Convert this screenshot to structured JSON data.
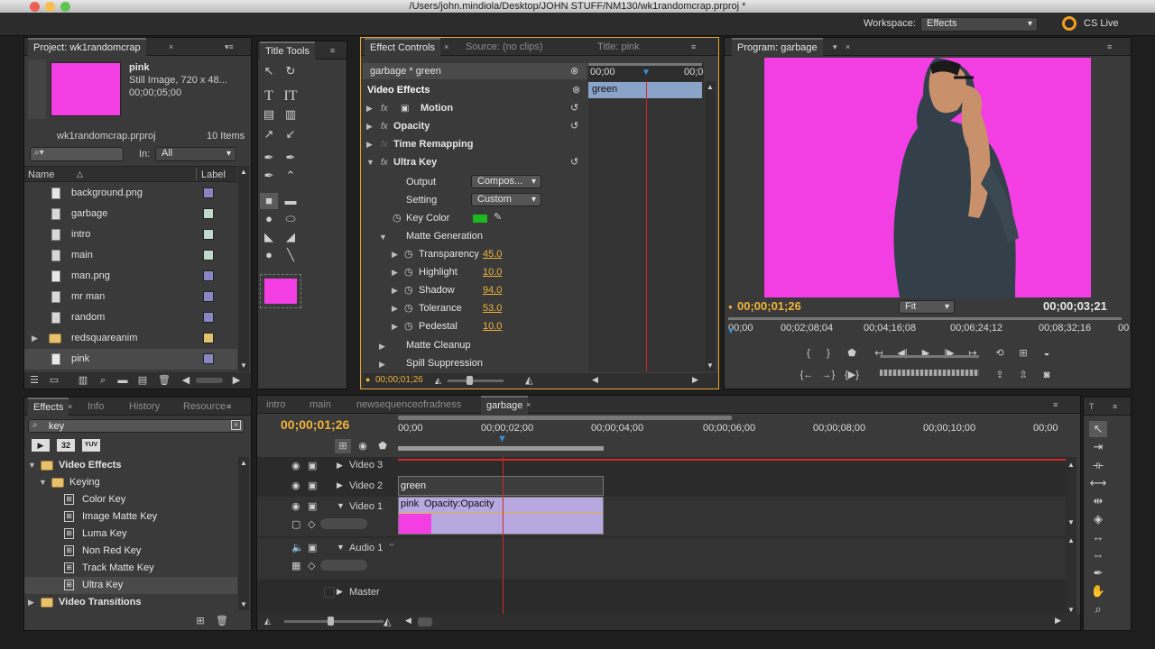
{
  "window": {
    "title": "/Users/john.mindiola/Desktop/JOHN STUFF/NM130/wk1randomcrap.prproj *"
  },
  "workspace": {
    "label": "Workspace:",
    "value": "Effects",
    "cs_live": "CS Live"
  },
  "project": {
    "tab": "Project: wk1randomcrap",
    "clip_name": "pink",
    "clip_type": "Still Image, 720 x 48...",
    "clip_duration": "00;00;05;00",
    "project_file": "wk1randomcrap.prproj",
    "item_count": "10 Items",
    "in_label": "In:",
    "in_value": "All",
    "col_name": "Name",
    "col_label": "Label",
    "items": [
      {
        "name": "background.png",
        "icon": "file-icon",
        "color": "#8a86c4"
      },
      {
        "name": "garbage",
        "icon": "sequence-icon",
        "color": "#c3d8cd"
      },
      {
        "name": "intro",
        "icon": "sequence-icon",
        "color": "#c3d8cd"
      },
      {
        "name": "main",
        "icon": "sequence-icon",
        "color": "#c3d8cd"
      },
      {
        "name": "man.png",
        "icon": "file-icon",
        "color": "#8a86c4"
      },
      {
        "name": "mr man",
        "icon": "sequence-icon",
        "color": "#8a86c4"
      },
      {
        "name": "random",
        "icon": "sequence-icon",
        "color": "#8a86c4"
      },
      {
        "name": "redsquareanim",
        "icon": "folder-icon",
        "color": "#e3c46e"
      },
      {
        "name": "pink",
        "icon": "file-icon",
        "color": "#8a86c4"
      }
    ]
  },
  "title_tools": {
    "tab": "Title Tools"
  },
  "effect_controls": {
    "tabs": [
      "Effect Controls",
      "Source: (no clips)",
      "Title: pink"
    ],
    "clip": "garbage * green",
    "video_effects": "Video Effects",
    "timecode_left": "00;00",
    "timecode_right": "00;0",
    "clip_bar": "green",
    "effects": [
      {
        "name": "Motion"
      },
      {
        "name": "Opacity"
      },
      {
        "name": "Time Remapping"
      },
      {
        "name": "Ultra Key"
      }
    ],
    "output_label": "Output",
    "output_value": "Compos...",
    "setting_label": "Setting",
    "setting_value": "Custom",
    "key_color_label": "Key Color",
    "key_color": "#1db81d",
    "matte_generation": "Matte Generation",
    "params": [
      {
        "name": "Transparency",
        "value": "45.0"
      },
      {
        "name": "Highlight",
        "value": "10.0"
      },
      {
        "name": "Shadow",
        "value": "94.0"
      },
      {
        "name": "Tolerance",
        "value": "53.0"
      },
      {
        "name": "Pedestal",
        "value": "10.0"
      }
    ],
    "matte_cleanup": "Matte Cleanup",
    "spill_suppression": "Spill Suppression",
    "current_time": "00;00;01;26"
  },
  "program": {
    "tab": "Program: garbage",
    "current_time": "00;00;01;26",
    "fit": "Fit",
    "duration": "00;00;03;21",
    "ruler": [
      "00;00",
      "00;02;08;04",
      "00;04;16;08",
      "00;06;24;12",
      "00;08;32;16",
      "00"
    ]
  },
  "effects_panel": {
    "tabs": [
      "Effects",
      "Info",
      "History",
      "Resource"
    ],
    "search": "key",
    "badges": [
      "32",
      "YUV"
    ],
    "video_effects": "Video Effects",
    "keying": "Keying",
    "items": [
      "Color Key",
      "Image Matte Key",
      "Luma Key",
      "Non Red Key",
      "Track Matte Key",
      "Ultra Key"
    ],
    "video_transitions": "Video Transitions"
  },
  "timeline": {
    "tabs": [
      "intro",
      "main",
      "newsequenceofradness",
      "garbage"
    ],
    "current_time": "00;00;01;26",
    "ruler": [
      "00;00",
      "00;00;02;00",
      "00;00;04;00",
      "00;00;06;00",
      "00;00;08;00",
      "00;00;10;00",
      "00;00"
    ],
    "tracks": [
      "Video 3",
      "Video 2",
      "Video 1",
      "Audio 1",
      "Master"
    ],
    "clip_green": "green",
    "clip_pink": "pink",
    "clip_pink_fx": "Opacity:Opacity"
  },
  "colors": {
    "magenta": "#f23ee3",
    "accent_orange": "#f0b43a",
    "playhead": "#d22a2a"
  }
}
